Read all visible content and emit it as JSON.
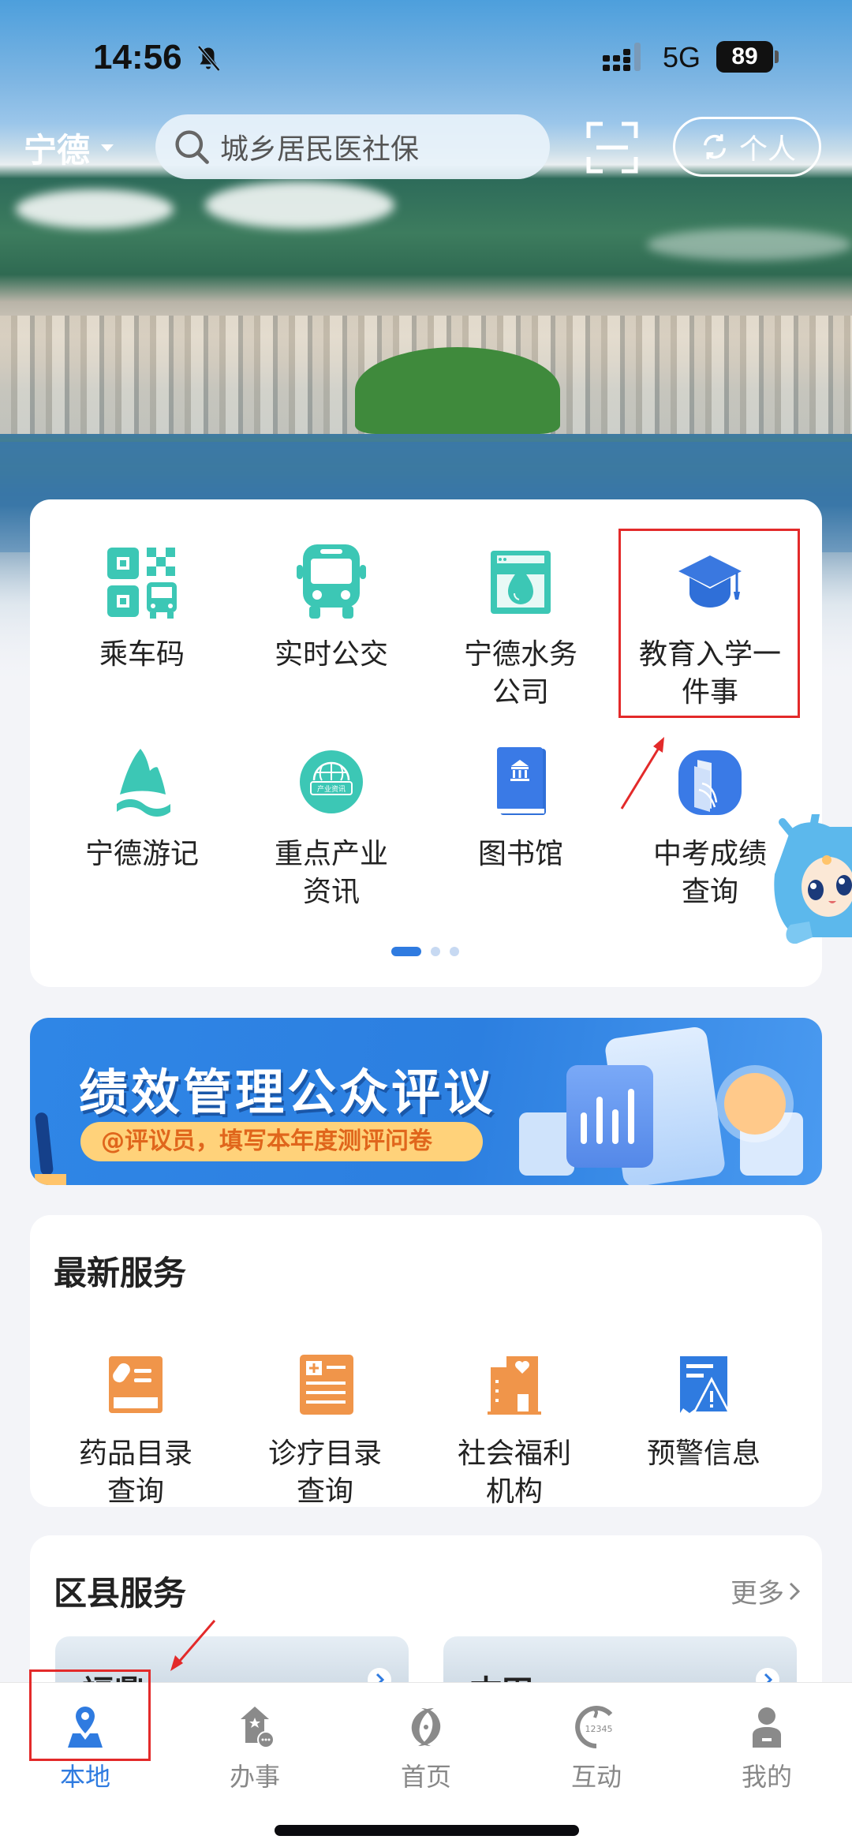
{
  "status_bar": {
    "time": "14:56",
    "silent_icon": "bell-slash-icon",
    "signal_icon": "cellular-signal-icon",
    "network": "5G",
    "battery": "89"
  },
  "top_bar": {
    "city": "宁德",
    "search_placeholder": "城乡居民医社保",
    "scan_icon": "scan-icon",
    "personal_label": "个人",
    "switch_icon": "refresh-icon"
  },
  "app_grid": {
    "items": [
      {
        "label": "乘车码",
        "icon": "qr-bus-icon",
        "color": "#3cc7b5"
      },
      {
        "label": "实时公交",
        "icon": "bus-icon",
        "color": "#3cc7b5"
      },
      {
        "label": "宁德水务\n公司",
        "icon": "water-drop-icon",
        "color": "#3cc7b5"
      },
      {
        "label": "教育入学一\n件事",
        "icon": "graduation-cap-icon",
        "color": "#2f7be0"
      },
      {
        "label": "宁德游记",
        "icon": "mountain-icon",
        "color": "#3cc7b5"
      },
      {
        "label": "重点产业\n资讯",
        "icon": "globe-news-icon",
        "color": "#3cc7b5",
        "badge": "产业资讯"
      },
      {
        "label": "图书馆",
        "icon": "library-book-icon",
        "color": "#2f7be0"
      },
      {
        "label": "中考成绩\n查询",
        "icon": "open-book-icon",
        "color": "#2f7be0"
      }
    ],
    "page_count": 3,
    "current_page": 1
  },
  "banner": {
    "title": "绩效管理公众评议",
    "subtitle": "@评议员，填写本年度测评问卷"
  },
  "latest_services": {
    "title": "最新服务",
    "items": [
      {
        "label": "药品目录\n查询",
        "icon": "medicine-card-icon",
        "color": "#f0954a"
      },
      {
        "label": "诊疗目录\n查询",
        "icon": "medical-record-icon",
        "color": "#f0954a"
      },
      {
        "label": "社会福利\n机构",
        "icon": "welfare-building-icon",
        "color": "#f0954a"
      },
      {
        "label": "预警信息",
        "icon": "warning-doc-icon",
        "color": "#2f7be0"
      }
    ]
  },
  "district_services": {
    "title": "区县服务",
    "more_label": "更多",
    "items": [
      {
        "name": "福鼎"
      },
      {
        "name": "古田"
      }
    ]
  },
  "bottom_nav": {
    "items": [
      {
        "label": "本地",
        "icon": "location-pin-icon",
        "active": true
      },
      {
        "label": "办事",
        "icon": "service-hall-icon",
        "active": false
      },
      {
        "label": "首页",
        "icon": "home-logo-icon",
        "active": false
      },
      {
        "label": "互动",
        "icon": "hotline-12345-icon",
        "active": false,
        "badge": "12345"
      },
      {
        "label": "我的",
        "icon": "user-icon",
        "active": false
      }
    ]
  },
  "colors": {
    "accent": "#2f7be0",
    "teal": "#3cc7b5",
    "orange": "#f0954a",
    "annotation_red": "#e32a2a"
  }
}
